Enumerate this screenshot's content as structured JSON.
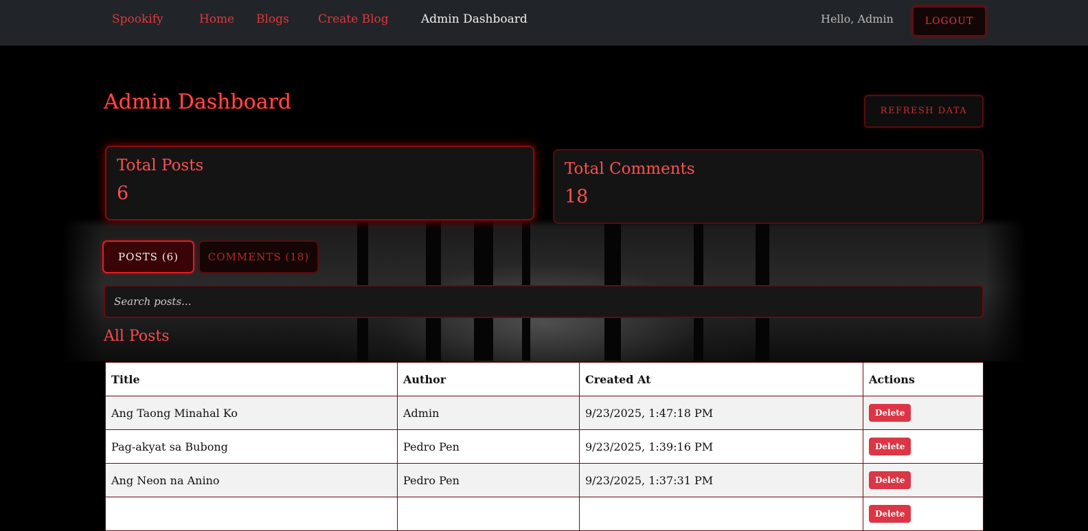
{
  "navbar": {
    "brand": "Spookify",
    "links": [
      "Home",
      "Blogs",
      "Create Blog",
      "Admin Dashboard"
    ],
    "active_link": "Admin Dashboard",
    "greeting": "Hello, Admin",
    "logout_label": "LOGOUT"
  },
  "header": {
    "title": "Admin Dashboard",
    "refresh_label": "REFRESH DATA"
  },
  "stats": {
    "posts": {
      "label": "Total Posts",
      "value": "6"
    },
    "comments": {
      "label": "Total Comments",
      "value": "18"
    }
  },
  "tabs": {
    "posts": "POSTS (6)",
    "comments": "COMMENTS (18)"
  },
  "search": {
    "placeholder": "Search posts..."
  },
  "posts_section": {
    "title": "All Posts",
    "columns": [
      "Title",
      "Author",
      "Created At",
      "Actions"
    ],
    "rows": [
      {
        "title": "Ang Taong Minahal Ko",
        "author": "Admin",
        "created_at": "9/23/2025, 1:47:18 PM",
        "action": "Delete"
      },
      {
        "title": "Pag-akyat sa Bubong",
        "author": "Pedro Pen",
        "created_at": "9/23/2025, 1:39:16 PM",
        "action": "Delete"
      },
      {
        "title": "Ang Neon na Anino",
        "author": "Pedro Pen",
        "created_at": "9/23/2025, 1:37:31 PM",
        "action": "Delete"
      },
      {
        "title": "",
        "author": "",
        "created_at": "",
        "action": "Delete"
      }
    ]
  },
  "colors": {
    "accent": "#e0363d",
    "navbar_bg": "#212529",
    "danger_button": "#dc3545"
  }
}
